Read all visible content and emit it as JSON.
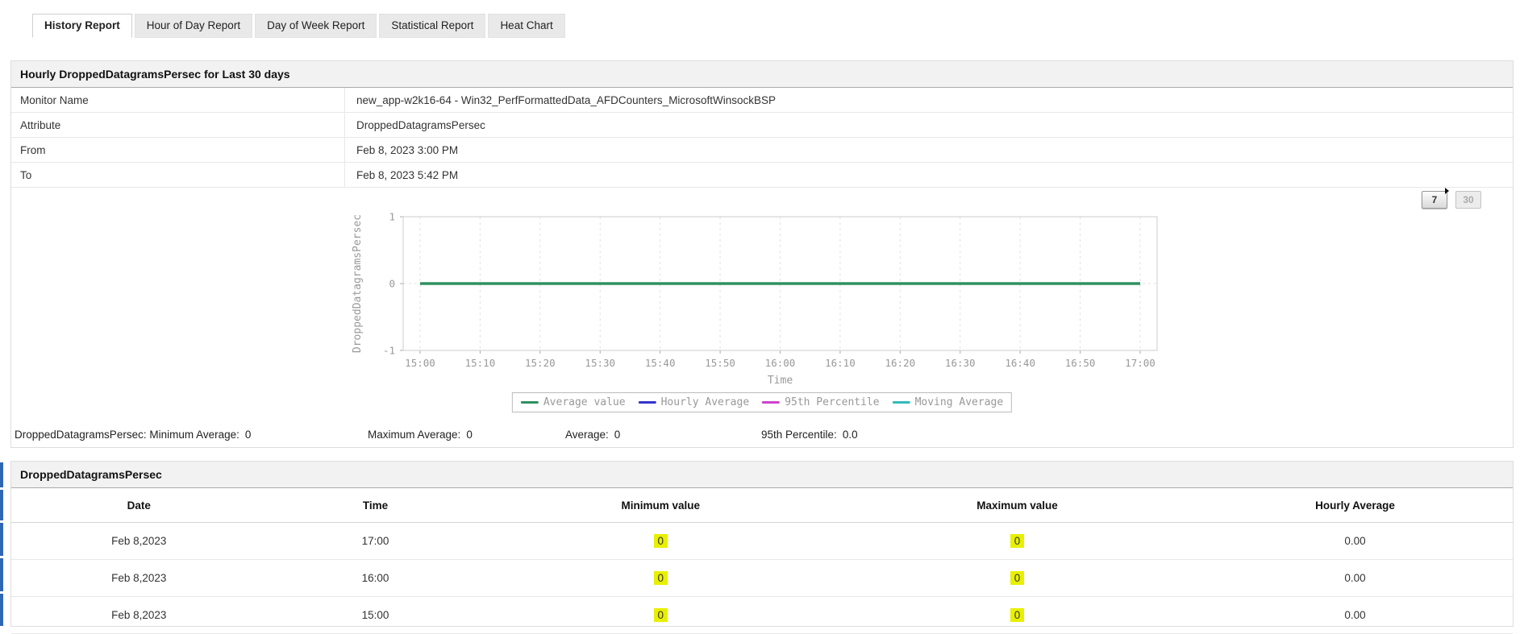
{
  "tabs": [
    {
      "label": "History Report",
      "active": true
    },
    {
      "label": "Hour of Day Report",
      "active": false
    },
    {
      "label": "Day of Week Report",
      "active": false
    },
    {
      "label": "Statistical Report",
      "active": false
    },
    {
      "label": "Heat Chart",
      "active": false
    }
  ],
  "report_panel": {
    "title": "Hourly DroppedDatagramsPersec for Last 30 days",
    "info_rows": [
      {
        "label": "Monitor Name",
        "value": "new_app-w2k16-64 - Win32_PerfFormattedData_AFDCounters_MicrosoftWinsockBSP"
      },
      {
        "label": "Attribute",
        "value": "DroppedDatagramsPersec"
      },
      {
        "label": "From",
        "value": "Feb 8, 2023 3:00 PM"
      },
      {
        "label": "To",
        "value": "Feb 8, 2023 5:42 PM"
      }
    ],
    "range_buttons": [
      {
        "label": "7",
        "enabled": true,
        "has_arrow": true
      },
      {
        "label": "30",
        "enabled": false,
        "has_arrow": false
      }
    ],
    "summary": [
      {
        "label": "DroppedDatagramsPersec: Minimum Average:",
        "value": "0"
      },
      {
        "label": "Maximum Average:",
        "value": "0"
      },
      {
        "label": "Average:",
        "value": "0"
      },
      {
        "label": "95th Percentile:",
        "value": "0.0"
      }
    ]
  },
  "chart_data": {
    "type": "line",
    "title": "",
    "xlabel": "Time",
    "ylabel": "DroppedDatagramsPersec",
    "x_ticks": [
      "15:00",
      "15:10",
      "15:20",
      "15:30",
      "15:40",
      "15:50",
      "16:00",
      "16:10",
      "16:20",
      "16:30",
      "16:40",
      "16:50",
      "17:00"
    ],
    "y_ticks": [
      1,
      0,
      -1
    ],
    "ylim": [
      -1,
      1
    ],
    "grid": "dashed",
    "legend_position": "bottom",
    "series": [
      {
        "name": "Average value",
        "color": "#2f9160",
        "x_range": [
          "15:00",
          "17:00"
        ],
        "constant_value": 0,
        "visible": true
      },
      {
        "name": "Hourly Average",
        "color": "#3333cc",
        "constant_value": null,
        "visible": false
      },
      {
        "name": "95th Percentile",
        "color": "#cc44cc",
        "constant_value": null,
        "visible": false
      },
      {
        "name": "Moving Average",
        "color": "#33bbbb",
        "constant_value": null,
        "visible": false
      }
    ]
  },
  "data_table": {
    "title": "DroppedDatagramsPersec",
    "columns": [
      "Date",
      "Time",
      "Minimum value",
      "Maximum value",
      "Hourly Average"
    ],
    "col_widths": [
      "17%",
      "14.5%",
      "23.5%",
      "24%",
      "21%"
    ],
    "highlight_color": "#e8f000",
    "rows": [
      {
        "date": "Feb 8,2023",
        "time": "17:00",
        "min": "0",
        "max": "0",
        "hourly_avg": "0.00"
      },
      {
        "date": "Feb 8,2023",
        "time": "16:00",
        "min": "0",
        "max": "0",
        "hourly_avg": "0.00"
      },
      {
        "date": "Feb 8,2023",
        "time": "15:00",
        "min": "0",
        "max": "0",
        "hourly_avg": "0.00"
      }
    ]
  }
}
